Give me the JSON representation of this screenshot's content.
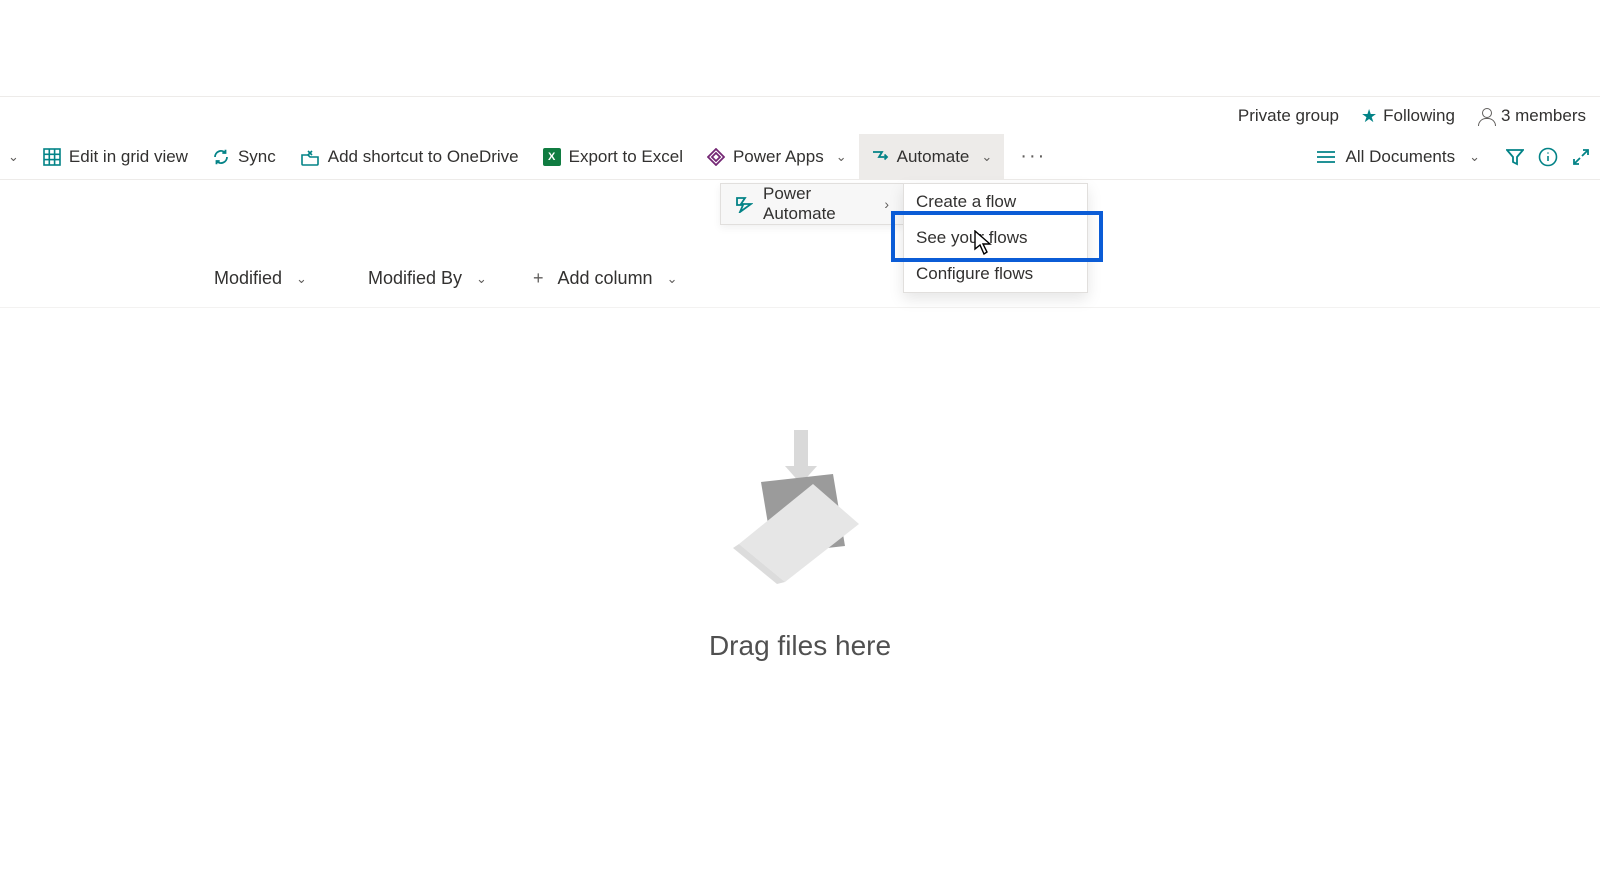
{
  "group": {
    "visibility": "Private group",
    "following_label": "Following",
    "members_label": "3 members"
  },
  "commandbar": {
    "chev_alone": "⌄",
    "edit_grid": "Edit in grid view",
    "sync": "Sync",
    "shortcut": "Add shortcut to OneDrive",
    "export": "Export to Excel",
    "excel_badge": "X",
    "power_apps": "Power Apps",
    "automate": "Automate",
    "more": "···",
    "view": "All Documents"
  },
  "automate_submenu": {
    "label": "Power Automate",
    "arrow": "›"
  },
  "automate_flyout": {
    "item0": "Create a flow",
    "item1": "See your flows",
    "item2": "Configure flows"
  },
  "columns": {
    "modified": "Modified",
    "modified_by": "Modified By",
    "add_column": "Add column"
  },
  "empty": {
    "caption": "Drag files here"
  }
}
